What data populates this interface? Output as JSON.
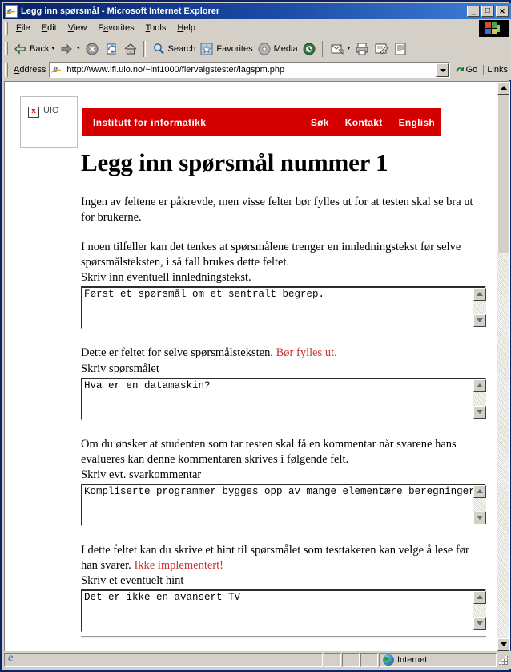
{
  "window": {
    "title": "Legg inn spørsmål - Microsoft Internet Explorer",
    "app_icon": "ie-page-icon",
    "minimize": "_",
    "maximize": "□",
    "close": "✕"
  },
  "menubar": {
    "items": [
      {
        "label": "File",
        "accel": "F"
      },
      {
        "label": "Edit",
        "accel": "E"
      },
      {
        "label": "View",
        "accel": "V"
      },
      {
        "label": "Favorites",
        "accel": "a"
      },
      {
        "label": "Tools",
        "accel": "T"
      },
      {
        "label": "Help",
        "accel": "H"
      }
    ],
    "brand_icon": "windows-flag-icon"
  },
  "toolbar": {
    "back": "Back",
    "forward": "",
    "stop": "",
    "refresh": "",
    "home": "",
    "search": "Search",
    "favorites": "Favorites",
    "media": "Media",
    "history": "",
    "mail": "",
    "print": "",
    "edit": "",
    "discuss": "",
    "icons": [
      "back-arrow-icon",
      "dropdown-arrow-icon",
      "forward-arrow-icon",
      "stop-icon",
      "refresh-icon",
      "home-icon",
      "search-magnifier-icon",
      "favorites-star-icon",
      "media-icon",
      "history-clock-icon",
      "mail-icon",
      "print-icon",
      "edit-icon",
      "discuss-icon"
    ]
  },
  "address_bar": {
    "label": "Address",
    "url": "http://www.ifi.uio.no/~inf1000/flervalgstester/lagspm.php",
    "go_label": "Go",
    "links_label": "Links",
    "page_icon": "ie-page-icon",
    "dropdown_icon": "chevron-down-icon",
    "go_icon": "go-arrow-icon"
  },
  "page": {
    "logo": {
      "alt_text": "UIO",
      "broken_marker": "x"
    },
    "banner": {
      "title": "Institutt for informatikk",
      "background": "#d40000",
      "nav": [
        "Søk",
        "Kontakt",
        "English"
      ]
    },
    "heading": "Legg inn spørsmål nummer 1",
    "intro_paragraph": "Ingen av feltene er påkrevde, men visse felter bør fylles ut for at testen skal se bra ut for brukerne.",
    "sections": [
      {
        "description": "I noen tilfeller kan det tenkes at spørsmålene trenger en innledningstekst før selve spørsmålsteksten, i så fall brukes dette feltet.",
        "note": "",
        "label": "Skriv inn eventuell innledningstekst.",
        "value": "Først et spørsmål om et sentralt begrep."
      },
      {
        "description": "Dette er feltet for selve spørsmålsteksten.",
        "note": "Bør fylles ut.",
        "label": "Skriv spørsmålet",
        "value": "Hva er en datamaskin?"
      },
      {
        "description": "Om du ønsker at studenten som tar testen skal få en kommentar når svarene hans evalueres kan denne kommentaren skrives i følgende felt.",
        "note": "",
        "label": "Skriv evt. svarkommentar",
        "value": "Kompliserte programmer bygges opp av mange elementære beregninger"
      },
      {
        "description": "I dette feltet kan du skrive et hint til spørsmålet som testtakeren kan velge å lese før han svarer.",
        "note": "Ikke implementert!",
        "label": "Skriv et eventuelt hint",
        "value": "Det er ikke en avansert TV"
      }
    ],
    "note_color": "#cc3333"
  },
  "statusbar": {
    "message": "",
    "zone_label": "Internet",
    "zone_icon": "globe-icon",
    "page_icon": "ie-page-icon"
  }
}
